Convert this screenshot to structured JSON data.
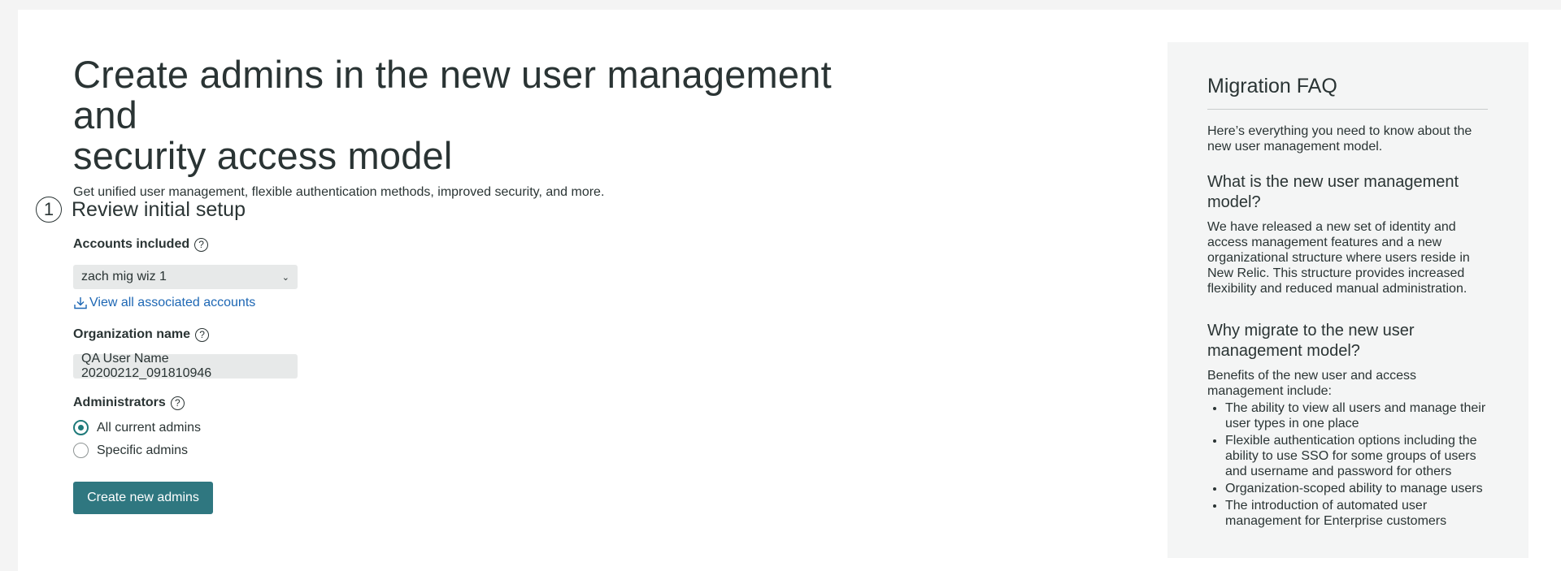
{
  "main": {
    "title_line1": "Create admins in the new user management and",
    "title_line2": "security access model",
    "subtitle": "Get unified user management, flexible authentication methods, improved security, and more.",
    "step": {
      "number": "1",
      "title": "Review initial setup"
    },
    "accounts": {
      "label": "Accounts included",
      "selected": "zach mig wiz 1",
      "link_label": "View all associated accounts"
    },
    "organization": {
      "label": "Organization name",
      "value": "QA User Name 20200212_091810946"
    },
    "administrators": {
      "label": "Administrators",
      "options": [
        {
          "label": "All current admins",
          "checked": true
        },
        {
          "label": "Specific admins",
          "checked": false
        }
      ]
    },
    "create_button": "Create new admins"
  },
  "faq": {
    "title": "Migration FAQ",
    "intro": "Here’s everything you need to know about the new user management model.",
    "q1": "What is the new user management model?",
    "a1": "We have released a new set of identity and access management features and a new organizational structure where users reside in New Relic. This structure provides increased flexibility and reduced manual administration.",
    "q2": "Why migrate to the new user management model?",
    "a2": "Benefits of the new user and access management include:",
    "benefits": [
      "The ability to view all users and manage their user types in one place",
      "Flexible authentication options including the ability to use SSO for some groups of users and username and password for others",
      "Organization-scoped ability to manage users",
      "The introduction of automated user management for Enterprise customers"
    ]
  },
  "colors": {
    "accent": "#2f7780",
    "link": "#1d67b4",
    "text": "#2a3434"
  }
}
